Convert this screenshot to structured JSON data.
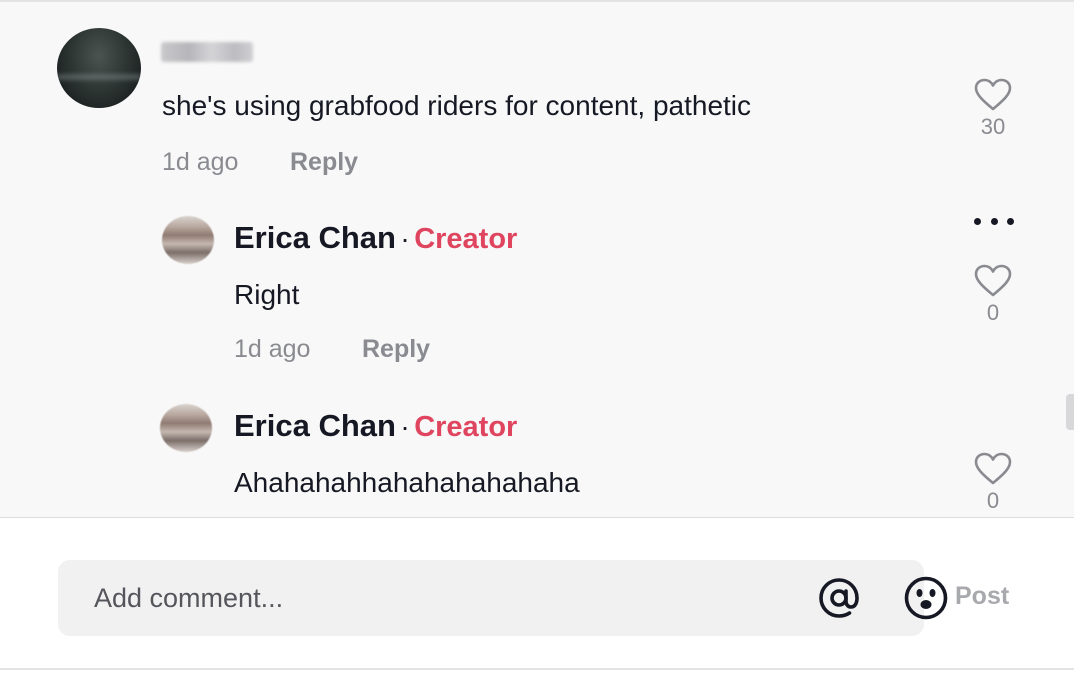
{
  "comments": {
    "main": {
      "username": "",
      "text": "she's using grabfood riders for content, pathetic",
      "time": "1d ago",
      "reply_label": "Reply",
      "likes": "30"
    },
    "replies": [
      {
        "author": "Erica Chan",
        "separator": "·",
        "badge": "Creator",
        "text": "Right",
        "time": "1d ago",
        "reply_label": "Reply",
        "likes": "0"
      },
      {
        "author": "Erica Chan",
        "separator": "·",
        "badge": "Creator",
        "text": "Ahahahahhahahahahahaha",
        "likes": "0"
      }
    ]
  },
  "composer": {
    "placeholder": "Add comment...",
    "value": "",
    "mention_icon": "at-sign-icon",
    "emoji_icon": "emoji-icon",
    "post_label": "Post"
  },
  "colors": {
    "creator_badge": "#e0455f",
    "muted_text": "#8a8b91",
    "comments_bg": "#f8f8f8",
    "input_bg": "#f1f1f2"
  }
}
